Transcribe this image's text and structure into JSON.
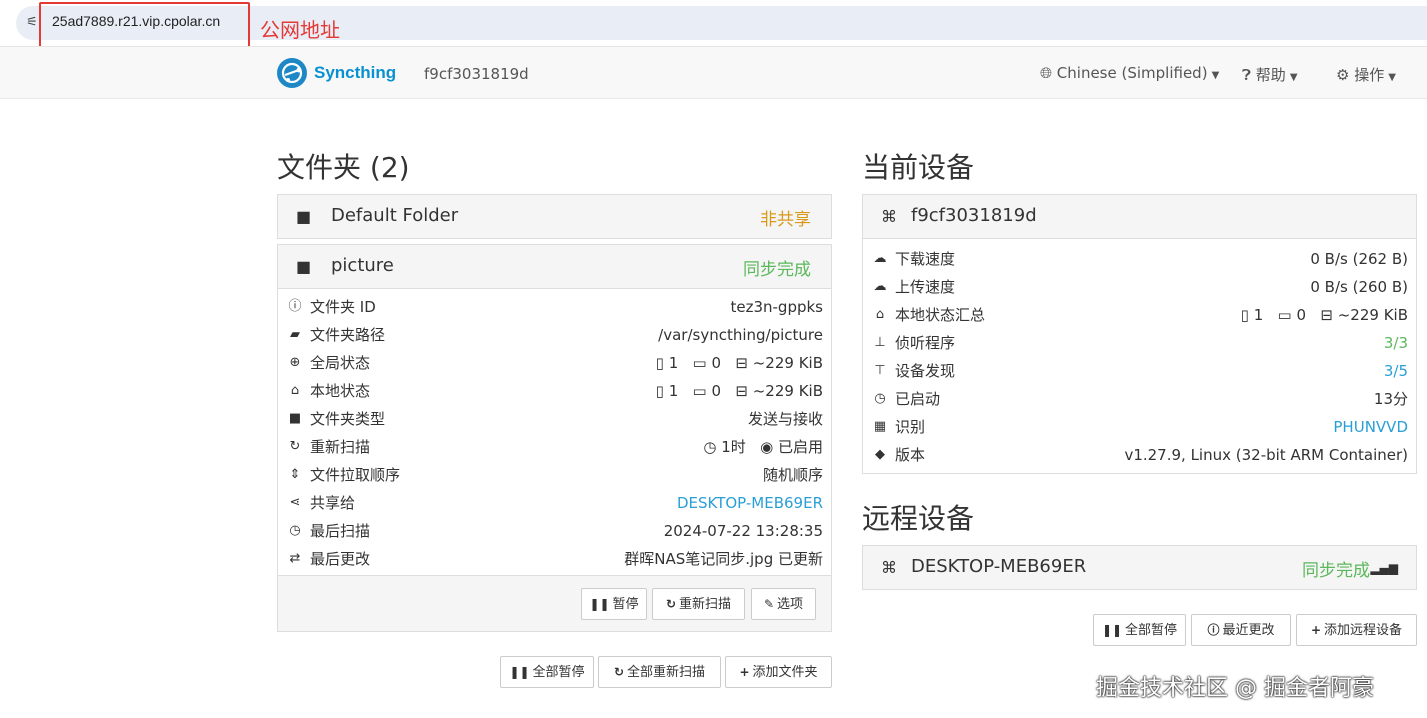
{
  "browser": {
    "url": "25ad7889.r21.vip.cpolar.cn",
    "annotation": "公网地址",
    "site_info_icon": "tune-icon"
  },
  "navbar": {
    "brand": "Syncthing",
    "device_id": "f9cf3031819d",
    "language": "Chinese (Simplified)",
    "help": "帮助",
    "actions": "操作"
  },
  "folders": {
    "heading": "文件夹 (2)",
    "list": [
      {
        "name": "Default Folder",
        "status": "非共享",
        "status_color": "#d99a1c"
      },
      {
        "name": "picture",
        "status": "同步完成",
        "status_color": "#5cb85c"
      }
    ],
    "details": {
      "folder_id": {
        "label": "文件夹 ID",
        "value": "tez3n-gppks"
      },
      "folder_path": {
        "label": "文件夹路径",
        "value": "/var/syncthing/picture"
      },
      "global_state": {
        "label": "全局状态",
        "files": "1",
        "dirs": "0",
        "size": "~229 KiB"
      },
      "local_state": {
        "label": "本地状态",
        "files": "1",
        "dirs": "0",
        "size": "~229 KiB"
      },
      "folder_type": {
        "label": "文件夹类型",
        "value": "发送与接收"
      },
      "rescan": {
        "label": "重新扫描",
        "interval": "1时",
        "watch": "已启用"
      },
      "pull_order": {
        "label": "文件拉取顺序",
        "value": "随机顺序"
      },
      "shared_with": {
        "label": "共享给",
        "value": "DESKTOP-MEB69ER"
      },
      "last_scan": {
        "label": "最后扫描",
        "value": "2024-07-22 13:28:35"
      },
      "last_change": {
        "label": "最后更改",
        "value": "群晖NAS笔记同步.jpg 已更新"
      }
    },
    "panel_buttons": {
      "pause": "暂停",
      "rescan": "重新扫描",
      "options": "选项"
    },
    "bottom_buttons": {
      "pause_all": "全部暂停",
      "rescan_all": "全部重新扫描",
      "add_folder": "添加文件夹"
    }
  },
  "this_device": {
    "heading": "当前设备",
    "name": "f9cf3031819d",
    "rows": {
      "download": {
        "label": "下载速度",
        "value": "0 B/s (262 B)"
      },
      "upload": {
        "label": "上传速度",
        "value": "0 B/s (260 B)"
      },
      "local_total": {
        "label": "本地状态汇总",
        "files": "1",
        "dirs": "0",
        "size": "~229 KiB"
      },
      "listeners": {
        "label": "侦听程序",
        "value": "3/3"
      },
      "discovery": {
        "label": "设备发现",
        "value": "3/5"
      },
      "uptime": {
        "label": "已启动",
        "value": "13分"
      },
      "identification": {
        "label": "识别",
        "value": "PHUNVVD"
      },
      "version": {
        "label": "版本",
        "value": "v1.27.9, Linux (32-bit ARM Container)"
      }
    }
  },
  "remote_devices": {
    "heading": "远程设备",
    "list": [
      {
        "name": "DESKTOP-MEB69ER",
        "status": "同步完成"
      }
    ],
    "buttons": {
      "pause_all": "全部暂停",
      "recent_changes": "最近更改",
      "add_remote": "添加远程设备"
    }
  },
  "watermark": "掘金技术社区 @ 掘金者阿豪",
  "colors": {
    "brand": "#0891d1",
    "link": "#2a9fd6",
    "success": "#5cb85c",
    "warning": "#d99a1c",
    "annotation": "#e53935"
  }
}
